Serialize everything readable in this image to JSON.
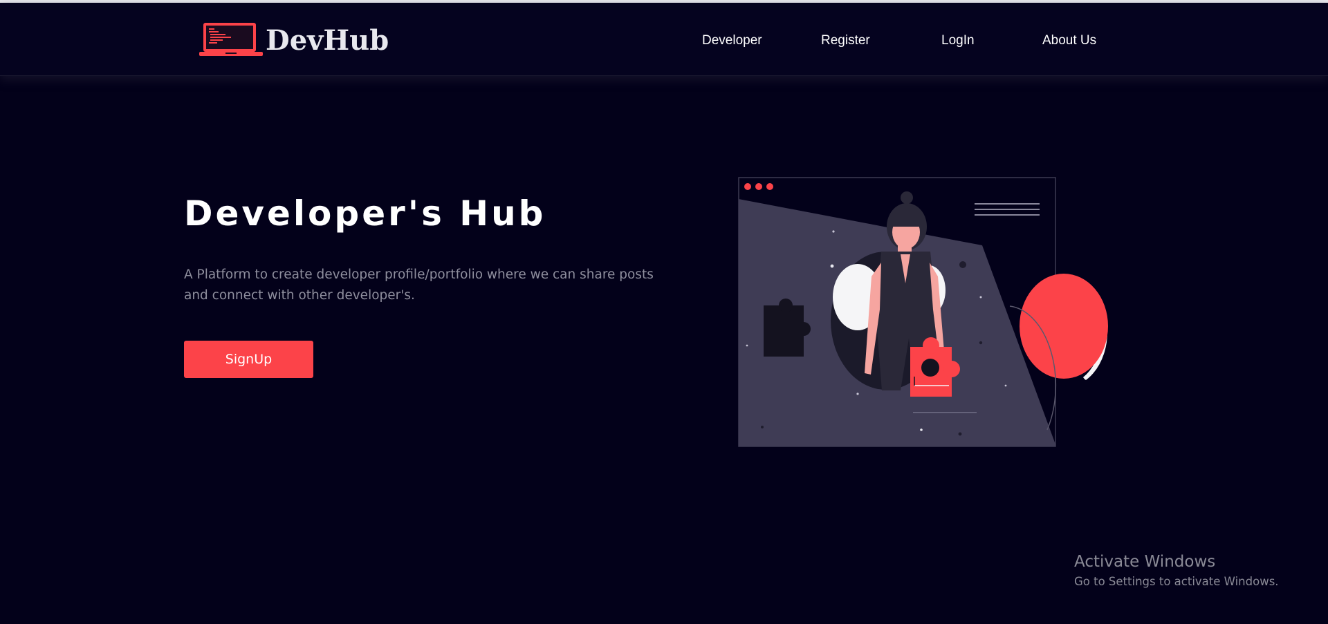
{
  "navbar": {
    "brand": "DevHub",
    "links": [
      {
        "label": "Developer"
      },
      {
        "label": "Register"
      },
      {
        "label": "LogIn"
      },
      {
        "label": "About Us"
      }
    ]
  },
  "hero": {
    "title": "Developer's Hub",
    "description": "A Platform to create developer profile/portfolio where we can share posts and connect with other developer's.",
    "signup_label": "SignUp"
  },
  "watermark": {
    "title": "Activate Windows",
    "subtitle": "Go to Settings to activate Windows."
  },
  "colors": {
    "background": "#03011a",
    "accent": "#fc4349",
    "panel": "#3f3c55"
  },
  "icons": {
    "logo": "laptop-code-icon"
  }
}
